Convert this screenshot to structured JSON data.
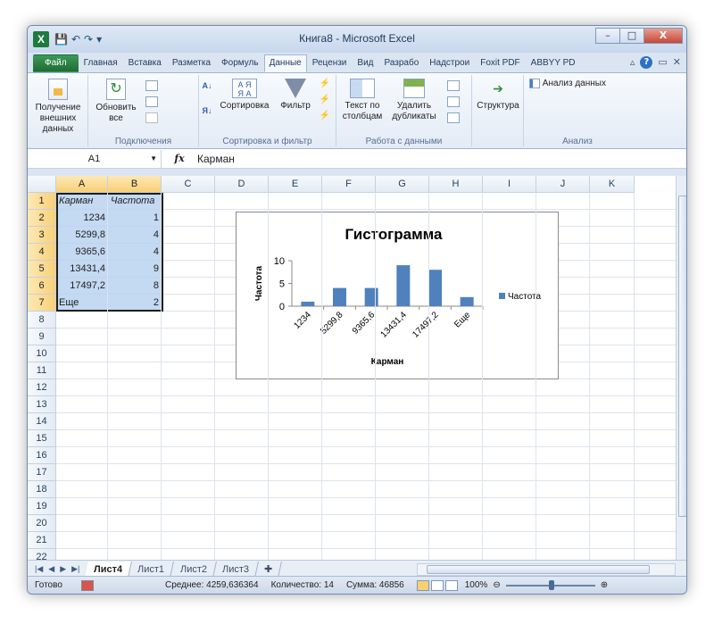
{
  "window": {
    "title": "Книга8 - Microsoft Excel",
    "app_icon": "X",
    "controls": {
      "minimize": "–",
      "maximize": "□",
      "close": "X"
    }
  },
  "qat": {
    "save": "💾",
    "undo": "↶",
    "redo": "↷",
    "more": "▾"
  },
  "tabs": [
    "Файл",
    "Главная",
    "Вставка",
    "Разметка",
    "Формуль",
    "Данные",
    "Рецензи",
    "Вид",
    "Разрабо",
    "Надстрои",
    "Foxit PDF",
    "ABBYY PD"
  ],
  "active_tab": "Данные",
  "ribbon": {
    "get_external": "Получение внешних данных",
    "refresh_all": "Обновить все",
    "sort": "Сортировка",
    "filter": "Фильтр",
    "text_to_columns": "Текст по столбцам",
    "remove_duplicates": "Удалить дубликаты",
    "outline": "Структура",
    "data_analysis": "Анализ данных",
    "groups": {
      "connections": "Подключения",
      "sort_filter": "Сортировка и фильтр",
      "data_tools": "Работа с данными",
      "analysis": "Анализ"
    }
  },
  "formula_bar": {
    "name_box": "A1",
    "fx": "fx",
    "value": "Карман"
  },
  "columns": [
    "A",
    "B",
    "C",
    "D",
    "E",
    "F",
    "G",
    "H",
    "I",
    "J",
    "K"
  ],
  "rows": [
    "1",
    "2",
    "3",
    "4",
    "5",
    "6",
    "7",
    "8",
    "9",
    "10",
    "11",
    "12",
    "13",
    "14",
    "15",
    "16",
    "17",
    "18",
    "19",
    "20",
    "21",
    "22"
  ],
  "cells": {
    "A1": "Карман",
    "B1": "Частота",
    "A2": "1234",
    "B2": "1",
    "A3": "5299,8",
    "B3": "4",
    "A4": "9365,6",
    "B4": "4",
    "A5": "13431,4",
    "B5": "9",
    "A6": "17497,2",
    "B6": "8",
    "A7": "Еще",
    "B7": "2"
  },
  "chart_data": {
    "type": "bar",
    "title": "Гистограмма",
    "xlabel": "Карман",
    "ylabel": "Частота",
    "categories": [
      "1234",
      "5299,8",
      "9365,6",
      "13431,4",
      "17497,2",
      "Еще"
    ],
    "series": [
      {
        "name": "Частота",
        "values": [
          1,
          4,
          4,
          9,
          8,
          2
        ]
      }
    ],
    "ylim": [
      0,
      10
    ],
    "yticks": [
      "0",
      "5",
      "10"
    ],
    "legend": "right",
    "bar_color": "#4f81bd"
  },
  "sheets": [
    "Лист4",
    "Лист1",
    "Лист2",
    "Лист3"
  ],
  "active_sheet": "Лист4",
  "status": {
    "ready": "Готово",
    "average": "Среднее: 4259,636364",
    "count": "Количество: 14",
    "sum": "Сумма: 46856",
    "zoom": "100%"
  }
}
